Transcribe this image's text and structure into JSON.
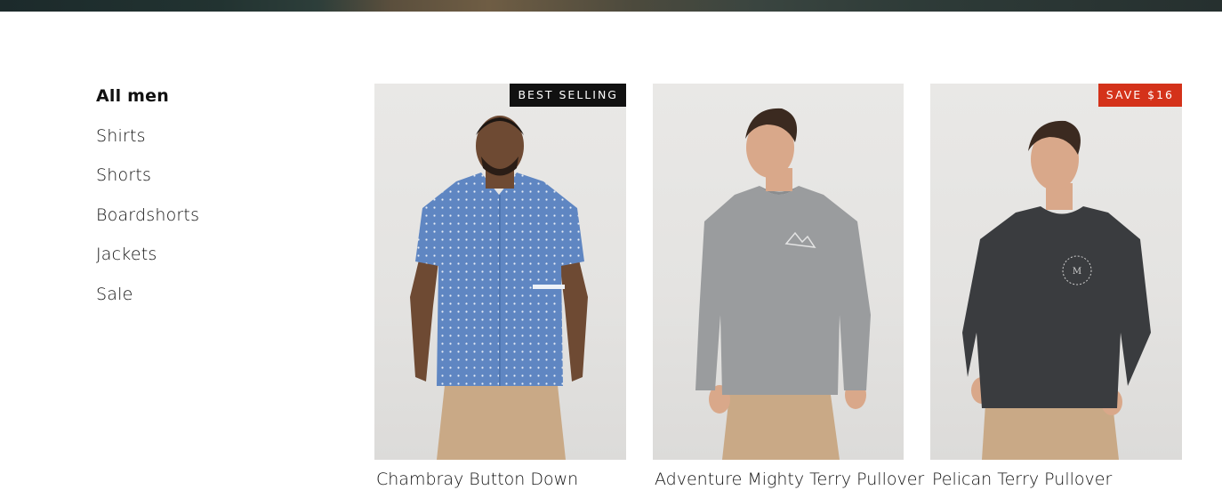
{
  "sidebar": {
    "items": [
      {
        "label": "All men",
        "active": true
      },
      {
        "label": "Shirts",
        "active": false
      },
      {
        "label": "Shorts",
        "active": false
      },
      {
        "label": "Boardshorts",
        "active": false
      },
      {
        "label": "Jackets",
        "active": false
      },
      {
        "label": "Sale",
        "active": false
      }
    ]
  },
  "products": [
    {
      "badge": "BEST SELLING",
      "badge_color": "#111111",
      "title": "Chambray Button Down",
      "shirt_color": "#5f86c2",
      "image_icon": "man-blue-dotted-shirt"
    },
    {
      "badge": "",
      "title": "Adventure Mighty Terry Pullover",
      "shirt_color": "#9a9c9e",
      "image_icon": "man-grey-sweatshirt"
    },
    {
      "badge": "SAVE $16",
      "badge_color": "#d4321a",
      "title": "Pelican Terry Pullover",
      "shirt_color": "#3a3c3f",
      "image_icon": "man-charcoal-sweatshirt"
    }
  ],
  "colors": {
    "pants": "#c9a986",
    "skin_dark": "#6e4a33",
    "skin_light": "#d9a88a",
    "hair": "#3b2a20"
  }
}
